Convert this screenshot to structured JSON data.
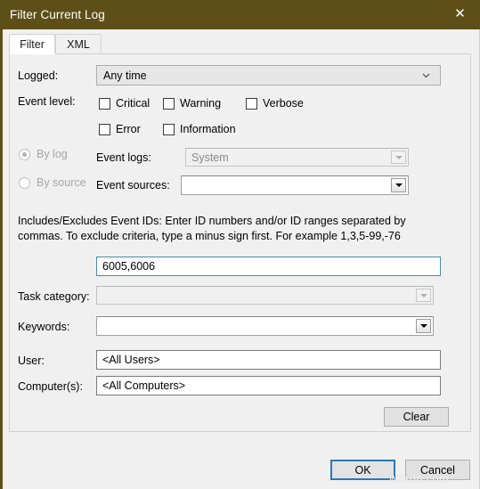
{
  "window": {
    "title": "Filter Current Log",
    "close_icon": "close-icon",
    "accent_color": "#5d4f17",
    "focus_color": "#2a79b7",
    "field_focus_color": "#4a8ab0",
    "background_color": "#f0f0f0"
  },
  "tabs": [
    {
      "label": "Filter",
      "active": true
    },
    {
      "label": "XML",
      "active": false
    }
  ],
  "form": {
    "logged": {
      "label": "Logged:",
      "value": "Any time",
      "icon": "chevron-down-icon"
    },
    "event_level": {
      "label": "Event level:",
      "options": [
        {
          "label": "Critical",
          "checked": false
        },
        {
          "label": "Warning",
          "checked": false
        },
        {
          "label": "Verbose",
          "checked": false
        },
        {
          "label": "Error",
          "checked": false
        },
        {
          "label": "Information",
          "checked": false
        }
      ]
    },
    "source_mode": {
      "by_log": {
        "label": "By log",
        "selected": true,
        "disabled": true
      },
      "by_source": {
        "label": "By source",
        "selected": false,
        "disabled": true
      }
    },
    "event_logs": {
      "label": "Event logs:",
      "value": "System",
      "disabled": true,
      "icon": "dropdown-arrow-icon"
    },
    "event_sources": {
      "label": "Event sources:",
      "value": "",
      "disabled": false,
      "icon": "dropdown-arrow-icon"
    },
    "event_ids_help": "Includes/Excludes Event IDs: Enter ID numbers and/or ID ranges separated by commas. To exclude criteria, type a minus sign first. For example 1,3,5-99,-76",
    "event_ids": {
      "value": "6005,6006",
      "focused": true
    },
    "task_category": {
      "label": "Task category:",
      "value": "",
      "disabled": true,
      "icon": "dropdown-arrow-icon"
    },
    "keywords": {
      "label": "Keywords:",
      "value": "",
      "disabled": false,
      "icon": "dropdown-arrow-icon"
    },
    "user": {
      "label": "User:",
      "value": "<All Users>"
    },
    "computers": {
      "label": "Computer(s):",
      "value": "<All Computers>"
    },
    "clear_button": "Clear"
  },
  "footer": {
    "ok_button": "OK",
    "cancel_button": "Cancel"
  },
  "watermark": "wsxdn.com"
}
